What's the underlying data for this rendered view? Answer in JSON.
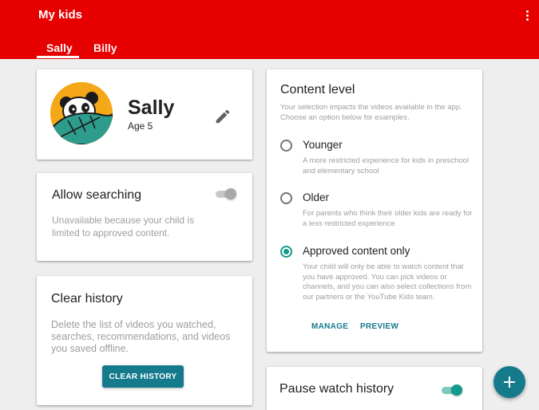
{
  "appbar": {
    "title": "My kids",
    "menu_icon": "more-vert-icon",
    "color": "#e60000"
  },
  "tabs": [
    {
      "label": "Sally",
      "selected": true
    },
    {
      "label": "Billy",
      "selected": false
    }
  ],
  "profile": {
    "name": "Sally",
    "age": "Age 5",
    "avatar_icon": "panda-leaf-avatar",
    "edit_icon": "pencil-icon"
  },
  "allow_searching": {
    "title": "Allow searching",
    "description": "Unavailable because your child is limited to approved content.",
    "enabled": false
  },
  "clear_history": {
    "title": "Clear history",
    "description": "Delete the list of videos you watched, searches, recommendations, and videos you saved offline.",
    "button": "CLEAR HISTORY"
  },
  "content_level": {
    "title": "Content level",
    "intro": "Your selection impacts the videos available in the app. Choose an option below for examples.",
    "options": [
      {
        "label": "Younger",
        "description": "A more restricted experience for kids in preschool and elementary school",
        "selected": false
      },
      {
        "label": "Older",
        "description": "For parents who think their older kids are ready for a less restricted experience",
        "selected": false
      },
      {
        "label": "Approved content only",
        "description": "Your child will only be able to watch content that you have approved. You can pick videos or channels, and you can also select collections from our partners or the YouTube Kids team.",
        "selected": true
      }
    ],
    "manage_label": "MANAGE",
    "preview_label": "PREVIEW"
  },
  "pause_history": {
    "title": "Pause watch history",
    "enabled": true
  },
  "fab": {
    "icon": "plus-icon"
  },
  "colors": {
    "accent": "#157a8c",
    "toggle_on": "#129b8a"
  }
}
